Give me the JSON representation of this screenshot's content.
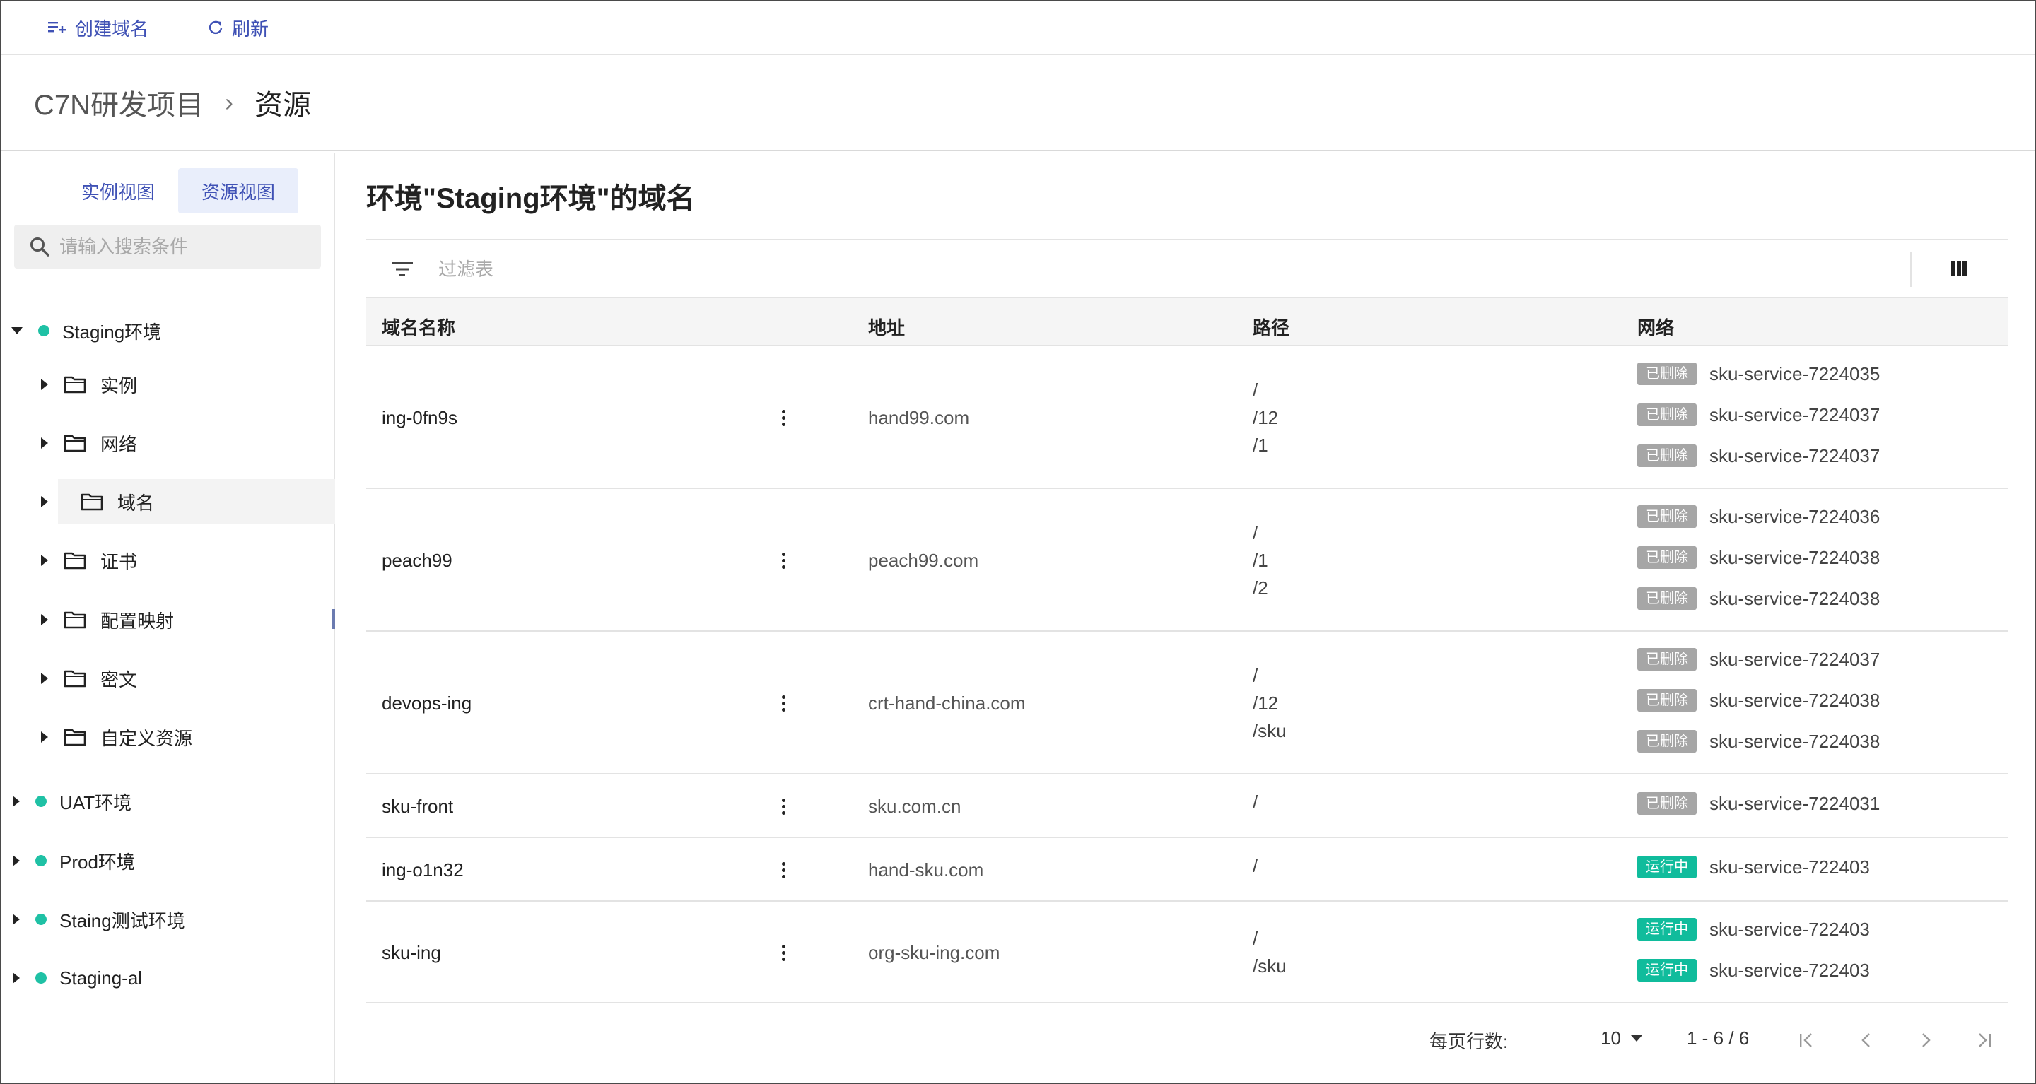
{
  "toolbar": {
    "create_label": "创建域名",
    "refresh_label": "刷新"
  },
  "breadcrumb": {
    "project": "C7N研发项目",
    "separator": "›",
    "page": "资源"
  },
  "sidebar": {
    "tabs": [
      "实例视图",
      "资源视图"
    ],
    "active_tab": 1,
    "search_placeholder": "请输入搜索条件",
    "tree": {
      "env_expanded": "Staging环境",
      "children": [
        "实例",
        "网络",
        "域名",
        "证书",
        "配置映射",
        "密文",
        "自定义资源"
      ],
      "selected_child": "域名",
      "other_envs": [
        "UAT环境",
        "Prod环境",
        "Staing测试环境",
        "Staging-al"
      ]
    }
  },
  "main": {
    "title": "环境\"Staging环境\"的域名",
    "filter_placeholder": "过滤表",
    "columns": [
      "域名名称",
      "地址",
      "路径",
      "网络"
    ],
    "rows": [
      {
        "name": "ing-0fn9s",
        "address": "hand99.com",
        "paths": [
          "/",
          "/12",
          "/1"
        ],
        "networks": [
          {
            "status": "已删除",
            "name": "sku-service-7224035"
          },
          {
            "status": "已删除",
            "name": "sku-service-7224037"
          },
          {
            "status": "已删除",
            "name": "sku-service-7224037"
          }
        ]
      },
      {
        "name": "peach99",
        "address": "peach99.com",
        "paths": [
          "/",
          "/1",
          "/2"
        ],
        "networks": [
          {
            "status": "已删除",
            "name": "sku-service-7224036"
          },
          {
            "status": "已删除",
            "name": "sku-service-7224038"
          },
          {
            "status": "已删除",
            "name": "sku-service-7224038"
          }
        ]
      },
      {
        "name": "devops-ing",
        "address": "crt-hand-china.com",
        "paths": [
          "/",
          "/12",
          "/sku"
        ],
        "networks": [
          {
            "status": "已删除",
            "name": "sku-service-7224037"
          },
          {
            "status": "已删除",
            "name": "sku-service-7224038"
          },
          {
            "status": "已删除",
            "name": "sku-service-7224038"
          }
        ]
      },
      {
        "name": "sku-front",
        "address": "sku.com.cn",
        "paths": [
          "/"
        ],
        "networks": [
          {
            "status": "已删除",
            "name": "sku-service-7224031"
          }
        ]
      },
      {
        "name": "ing-o1n32",
        "address": "hand-sku.com",
        "paths": [
          "/"
        ],
        "networks": [
          {
            "status": "运行中",
            "name": "sku-service-722403"
          }
        ]
      },
      {
        "name": "sku-ing",
        "address": "org-sku-ing.com",
        "paths": [
          "/",
          "/sku"
        ],
        "networks": [
          {
            "status": "运行中",
            "name": "sku-service-722403"
          },
          {
            "status": "运行中",
            "name": "sku-service-722403"
          }
        ]
      }
    ]
  },
  "pagination": {
    "rows_per_page_label": "每页行数:",
    "rows_per_page": "10",
    "range": "1 - 6 / 6"
  },
  "colors": {
    "accent": "#3f51b5",
    "status_dot": "#1fc1a5",
    "badge_deleted": "#a6a6a6",
    "badge_running": "#10bc9c"
  },
  "icons": {
    "create": "playlist-add-icon",
    "refresh": "refresh-icon",
    "search": "search-icon",
    "filter": "filter-icon",
    "columns": "view-column-icon",
    "folder": "folder-icon"
  }
}
